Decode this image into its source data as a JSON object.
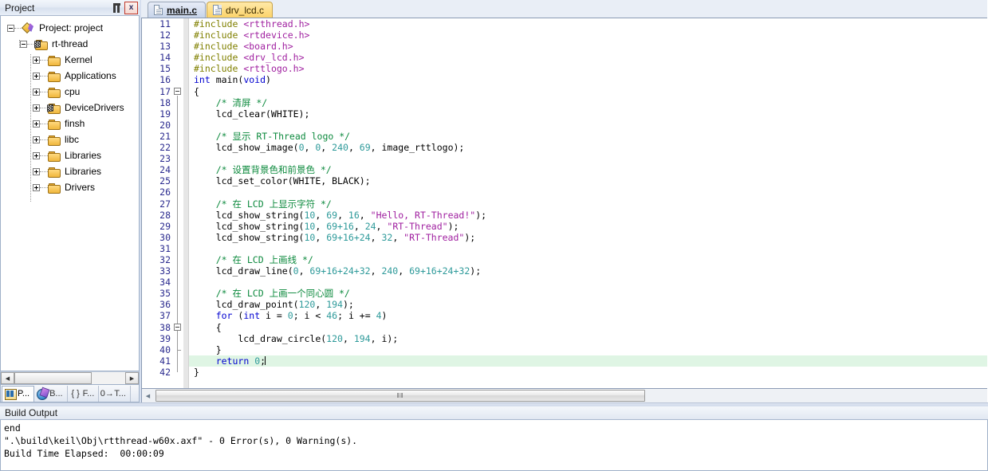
{
  "project_pane": {
    "title": "Project",
    "pin_tooltip": "Auto Hide",
    "close_label": "x",
    "tree": [
      {
        "label": "Project: project",
        "indent": 0,
        "expander": "minus",
        "icon": "project-icon"
      },
      {
        "label": "rt-thread",
        "indent": 1,
        "expander": "minus",
        "icon": "folder-flag-icon"
      },
      {
        "label": "Kernel",
        "indent": 2,
        "expander": "plus",
        "icon": "folder-icon"
      },
      {
        "label": "Applications",
        "indent": 2,
        "expander": "plus",
        "icon": "folder-icon"
      },
      {
        "label": "cpu",
        "indent": 2,
        "expander": "plus",
        "icon": "folder-icon"
      },
      {
        "label": "DeviceDrivers",
        "indent": 2,
        "expander": "plus",
        "icon": "folder-flag-icon"
      },
      {
        "label": "finsh",
        "indent": 2,
        "expander": "plus",
        "icon": "folder-icon"
      },
      {
        "label": "libc",
        "indent": 2,
        "expander": "plus",
        "icon": "folder-icon"
      },
      {
        "label": "Libraries",
        "indent": 2,
        "expander": "plus",
        "icon": "folder-icon"
      },
      {
        "label": "Libraries",
        "indent": 2,
        "expander": "plus",
        "icon": "folder-icon"
      },
      {
        "label": "Drivers",
        "indent": 2,
        "expander": "plus",
        "icon": "folder-icon"
      }
    ],
    "bottom_tabs": [
      {
        "label": "P...",
        "icon": "project-window-icon",
        "active": true
      },
      {
        "label": "B...",
        "icon": "books-icon",
        "active": false
      },
      {
        "label": "F...",
        "icon": "braces-icon",
        "active": false
      },
      {
        "label": "T...",
        "icon": "templates-icon",
        "active": false
      }
    ],
    "scroll_left_arrow": "◀",
    "scroll_right_arrow": "▶"
  },
  "editor": {
    "tabs": [
      {
        "label": "main.c",
        "active": true
      },
      {
        "label": "drv_lcd.c",
        "active": false
      }
    ],
    "first_line_number": 11,
    "cursor_line": 41,
    "lines": [
      {
        "n": 11,
        "tokens": [
          {
            "t": "pre",
            "v": "#include"
          },
          {
            "t": "id",
            "v": " "
          },
          {
            "t": "inc",
            "v": "<rtthread.h>"
          }
        ]
      },
      {
        "n": 12,
        "tokens": [
          {
            "t": "pre",
            "v": "#include"
          },
          {
            "t": "id",
            "v": " "
          },
          {
            "t": "inc",
            "v": "<rtdevice.h>"
          }
        ]
      },
      {
        "n": 13,
        "tokens": [
          {
            "t": "pre",
            "v": "#include"
          },
          {
            "t": "id",
            "v": " "
          },
          {
            "t": "inc",
            "v": "<board.h>"
          }
        ]
      },
      {
        "n": 14,
        "tokens": [
          {
            "t": "pre",
            "v": "#include"
          },
          {
            "t": "id",
            "v": " "
          },
          {
            "t": "inc",
            "v": "<drv_lcd.h>"
          }
        ]
      },
      {
        "n": 15,
        "tokens": [
          {
            "t": "pre",
            "v": "#include"
          },
          {
            "t": "id",
            "v": " "
          },
          {
            "t": "inc",
            "v": "<rttlogo.h>"
          }
        ]
      },
      {
        "n": 16,
        "tokens": [
          {
            "t": "kw",
            "v": "int"
          },
          {
            "t": "id",
            "v": " main("
          },
          {
            "t": "kw",
            "v": "void"
          },
          {
            "t": "id",
            "v": ")"
          }
        ]
      },
      {
        "n": 17,
        "tokens": [
          {
            "t": "id",
            "v": "{"
          }
        ],
        "fold": "open"
      },
      {
        "n": 18,
        "tokens": [
          {
            "t": "cmt",
            "v": "    /* 清屏 */"
          }
        ]
      },
      {
        "n": 19,
        "tokens": [
          {
            "t": "id",
            "v": "    lcd_clear(WHITE);"
          }
        ]
      },
      {
        "n": 20,
        "tokens": [
          {
            "t": "id",
            "v": ""
          }
        ]
      },
      {
        "n": 21,
        "tokens": [
          {
            "t": "cmt",
            "v": "    /* 显示 RT-Thread logo */"
          }
        ]
      },
      {
        "n": 22,
        "tokens": [
          {
            "t": "id",
            "v": "    lcd_show_image("
          },
          {
            "t": "num",
            "v": "0"
          },
          {
            "t": "id",
            "v": ", "
          },
          {
            "t": "num",
            "v": "0"
          },
          {
            "t": "id",
            "v": ", "
          },
          {
            "t": "num",
            "v": "240"
          },
          {
            "t": "id",
            "v": ", "
          },
          {
            "t": "num",
            "v": "69"
          },
          {
            "t": "id",
            "v": ", image_rttlogo);"
          }
        ]
      },
      {
        "n": 23,
        "tokens": [
          {
            "t": "id",
            "v": ""
          }
        ]
      },
      {
        "n": 24,
        "tokens": [
          {
            "t": "cmt",
            "v": "    /* 设置背景色和前景色 */"
          }
        ]
      },
      {
        "n": 25,
        "tokens": [
          {
            "t": "id",
            "v": "    lcd_set_color(WHITE, BLACK);"
          }
        ]
      },
      {
        "n": 26,
        "tokens": [
          {
            "t": "id",
            "v": ""
          }
        ]
      },
      {
        "n": 27,
        "tokens": [
          {
            "t": "cmt",
            "v": "    /* 在 LCD 上显示字符 */"
          }
        ]
      },
      {
        "n": 28,
        "tokens": [
          {
            "t": "id",
            "v": "    lcd_show_string("
          },
          {
            "t": "num",
            "v": "10"
          },
          {
            "t": "id",
            "v": ", "
          },
          {
            "t": "num",
            "v": "69"
          },
          {
            "t": "id",
            "v": ", "
          },
          {
            "t": "num",
            "v": "16"
          },
          {
            "t": "id",
            "v": ", "
          },
          {
            "t": "str",
            "v": "\"Hello, RT-Thread!\""
          },
          {
            "t": "id",
            "v": ");"
          }
        ]
      },
      {
        "n": 29,
        "tokens": [
          {
            "t": "id",
            "v": "    lcd_show_string("
          },
          {
            "t": "num",
            "v": "10"
          },
          {
            "t": "id",
            "v": ", "
          },
          {
            "t": "num",
            "v": "69+16"
          },
          {
            "t": "id",
            "v": ", "
          },
          {
            "t": "num",
            "v": "24"
          },
          {
            "t": "id",
            "v": ", "
          },
          {
            "t": "str",
            "v": "\"RT-Thread\""
          },
          {
            "t": "id",
            "v": ");"
          }
        ]
      },
      {
        "n": 30,
        "tokens": [
          {
            "t": "id",
            "v": "    lcd_show_string("
          },
          {
            "t": "num",
            "v": "10"
          },
          {
            "t": "id",
            "v": ", "
          },
          {
            "t": "num",
            "v": "69+16+24"
          },
          {
            "t": "id",
            "v": ", "
          },
          {
            "t": "num",
            "v": "32"
          },
          {
            "t": "id",
            "v": ", "
          },
          {
            "t": "str",
            "v": "\"RT-Thread\""
          },
          {
            "t": "id",
            "v": ");"
          }
        ]
      },
      {
        "n": 31,
        "tokens": [
          {
            "t": "id",
            "v": ""
          }
        ]
      },
      {
        "n": 32,
        "tokens": [
          {
            "t": "cmt",
            "v": "    /* 在 LCD 上画线 */"
          }
        ]
      },
      {
        "n": 33,
        "tokens": [
          {
            "t": "id",
            "v": "    lcd_draw_line("
          },
          {
            "t": "num",
            "v": "0"
          },
          {
            "t": "id",
            "v": ", "
          },
          {
            "t": "num",
            "v": "69+16+24+32"
          },
          {
            "t": "id",
            "v": ", "
          },
          {
            "t": "num",
            "v": "240"
          },
          {
            "t": "id",
            "v": ", "
          },
          {
            "t": "num",
            "v": "69+16+24+32"
          },
          {
            "t": "id",
            "v": ");"
          }
        ]
      },
      {
        "n": 34,
        "tokens": [
          {
            "t": "id",
            "v": ""
          }
        ]
      },
      {
        "n": 35,
        "tokens": [
          {
            "t": "cmt",
            "v": "    /* 在 LCD 上画一个同心圆 */"
          }
        ]
      },
      {
        "n": 36,
        "tokens": [
          {
            "t": "id",
            "v": "    lcd_draw_point("
          },
          {
            "t": "num",
            "v": "120"
          },
          {
            "t": "id",
            "v": ", "
          },
          {
            "t": "num",
            "v": "194"
          },
          {
            "t": "id",
            "v": ");"
          }
        ]
      },
      {
        "n": 37,
        "tokens": [
          {
            "t": "id",
            "v": "    "
          },
          {
            "t": "kw",
            "v": "for"
          },
          {
            "t": "id",
            "v": " ("
          },
          {
            "t": "kw",
            "v": "int"
          },
          {
            "t": "id",
            "v": " i = "
          },
          {
            "t": "num",
            "v": "0"
          },
          {
            "t": "id",
            "v": "; i < "
          },
          {
            "t": "num",
            "v": "46"
          },
          {
            "t": "id",
            "v": "; i += "
          },
          {
            "t": "num",
            "v": "4"
          },
          {
            "t": "id",
            "v": ")"
          }
        ]
      },
      {
        "n": 38,
        "tokens": [
          {
            "t": "id",
            "v": "    {"
          }
        ],
        "fold": "open"
      },
      {
        "n": 39,
        "tokens": [
          {
            "t": "id",
            "v": "        lcd_draw_circle("
          },
          {
            "t": "num",
            "v": "120"
          },
          {
            "t": "id",
            "v": ", "
          },
          {
            "t": "num",
            "v": "194"
          },
          {
            "t": "id",
            "v": ", i);"
          }
        ]
      },
      {
        "n": 40,
        "tokens": [
          {
            "t": "id",
            "v": "    }"
          }
        ],
        "fold": "close"
      },
      {
        "n": 41,
        "tokens": [
          {
            "t": "id",
            "v": "    "
          },
          {
            "t": "kw",
            "v": "return"
          },
          {
            "t": "id",
            "v": " "
          },
          {
            "t": "num",
            "v": "0"
          },
          {
            "t": "id",
            "v": ";"
          }
        ],
        "highlight": true,
        "caret": true
      },
      {
        "n": 42,
        "tokens": [
          {
            "t": "id",
            "v": "}"
          }
        ]
      }
    ],
    "hscroll_grip": "‖‖",
    "hscroll_left_arrow": "◀"
  },
  "build_output": {
    "title": "Build Output",
    "lines": [
      "end",
      "\".\\build\\keil\\Obj\\rtthread-w60x.axf\" - 0 Error(s), 0 Warning(s).",
      "Build Time Elapsed:  00:00:09"
    ]
  },
  "colors": {
    "preprocessor": "#808000",
    "include_path": "#a020a0",
    "keyword": "#0000d0",
    "number": "#2e9a9a",
    "string": "#a020a0",
    "comment": "#0d8a3e",
    "current_line_bg": "#dff5e4",
    "active_tab_bg": "#c7d4ea",
    "inactive_tab_bg": "#fcd36a"
  }
}
